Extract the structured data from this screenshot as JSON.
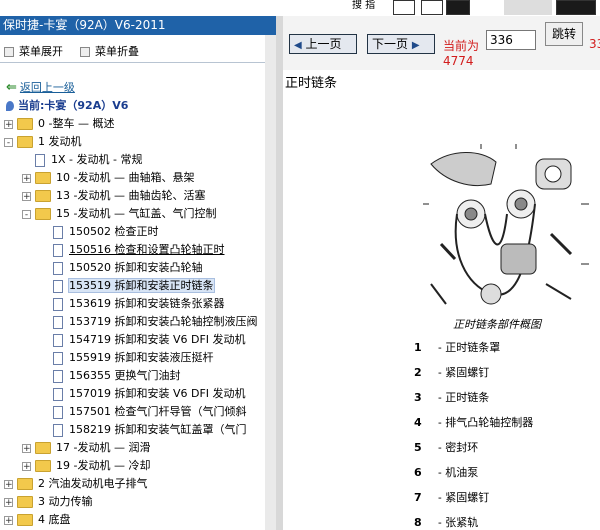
{
  "window": {
    "title": "保时捷-卡宴（92A）V6-2011"
  },
  "topstrip": {
    "label": "搜 指"
  },
  "left": {
    "expand_all": "菜单展开",
    "collapse_all": "菜单折叠",
    "back": "返回上一级",
    "current": "当前:卡宴（92A）V6"
  },
  "tree": [
    {
      "label": "0  -整车 — 概述",
      "type": "folder",
      "sign": "+"
    },
    {
      "label": "1  发动机",
      "type": "folder",
      "sign": "-"
    },
    {
      "label": "1X  - 发动机 - 常规",
      "type": "doc"
    },
    {
      "label": "10  -发动机 — 曲轴箱、悬架",
      "type": "folder",
      "sign": "+"
    },
    {
      "label": "13  -发动机 — 曲轴齿轮、活塞",
      "type": "folder",
      "sign": "+"
    },
    {
      "label": "15  -发动机 — 气缸盖、气门控制",
      "type": "folder",
      "sign": "-"
    },
    {
      "label": "150502  检查正时",
      "type": "doc"
    },
    {
      "label": "150516  检查和设置凸轮轴正时",
      "type": "doc",
      "underline": true
    },
    {
      "label": "150520  拆卸和安装凸轮轴",
      "type": "doc"
    },
    {
      "label": "153519  拆卸和安装正时链条",
      "type": "doc",
      "selected": true
    },
    {
      "label": "153619  拆卸和安装链条张紧器",
      "type": "doc"
    },
    {
      "label": "153719  拆卸和安装凸轮轴控制液压阀",
      "type": "doc"
    },
    {
      "label": "154719  拆卸和安装 V6 DFI 发动机",
      "type": "doc"
    },
    {
      "label": "155919  拆卸和安装液压挺杆",
      "type": "doc"
    },
    {
      "label": "156355  更换气门油封",
      "type": "doc"
    },
    {
      "label": "157019  拆卸和安装 V6 DFI 发动机",
      "type": "doc"
    },
    {
      "label": "157501  检查气门杆导管（气门倾斜",
      "type": "doc"
    },
    {
      "label": "158219  拆卸和安装气缸盖罩（气门",
      "type": "doc"
    },
    {
      "label": "17  -发动机 — 润滑",
      "type": "folder",
      "sign": "+"
    },
    {
      "label": "19  -发动机 — 冷却",
      "type": "folder",
      "sign": "+"
    },
    {
      "label": "2  汽油发动机电子排气",
      "type": "folder",
      "sign": "+"
    },
    {
      "label": "3  动力传输",
      "type": "folder",
      "sign": "+"
    },
    {
      "label": "4  底盘",
      "type": "folder",
      "sign": "+"
    }
  ],
  "nav": {
    "prev": "上一页",
    "next": "下一页",
    "current_label": "当前为",
    "page_value": "336",
    "total": "4774",
    "go": "跳转",
    "cut": "33"
  },
  "doc": {
    "section_title": "正时链条",
    "caption": "正时链条部件概图",
    "parts": [
      {
        "num": "1",
        "text": "- 正时链条罩"
      },
      {
        "num": "2",
        "text": "- 紧固螺钉"
      },
      {
        "num": "3",
        "text": "- 正时链条"
      },
      {
        "num": "4",
        "text": "- 排气凸轮轴控制器"
      },
      {
        "num": "5",
        "text": "- 密封环"
      },
      {
        "num": "6",
        "text": "- 机油泵"
      },
      {
        "num": "7",
        "text": "- 紧固螺钉"
      },
      {
        "num": "8",
        "text": "- 张紧轨"
      }
    ]
  },
  "colors": {
    "title_bar": "#1f62a8",
    "red_text": "#d21c1c",
    "selection": "#d7e4f5"
  }
}
